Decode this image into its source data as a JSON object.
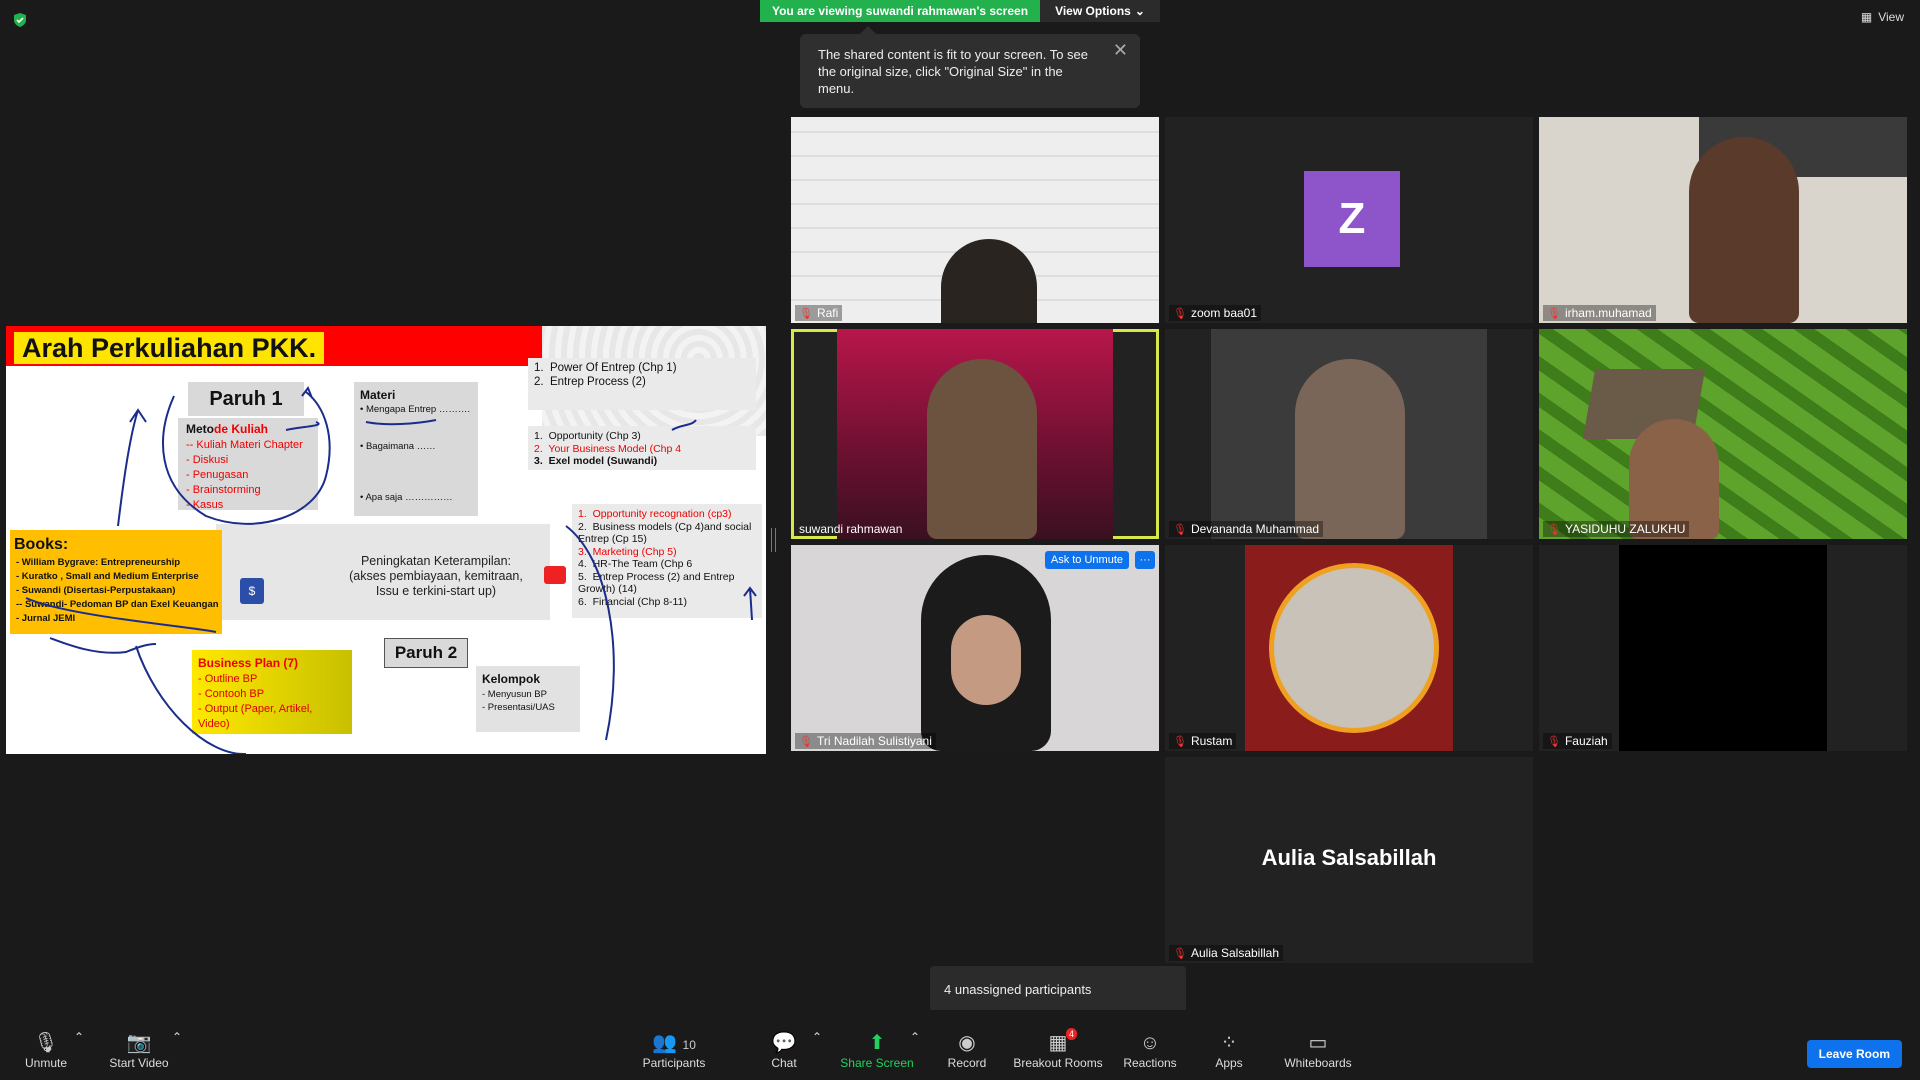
{
  "top": {
    "viewing_banner": "You are viewing suwandi rahmawan's screen",
    "view_options": "View Options",
    "view_btn": "View",
    "tooltip": "The shared content is fit to your screen. To see the original size, click \"Original Size\" in the menu."
  },
  "slide": {
    "title": "Arah Perkuliahan PKK.",
    "paruh1": "Paruh 1",
    "paruh2": "Paruh 2",
    "metode_title_a": "Meto",
    "metode_title_b": "de Kuliah",
    "metode_items": [
      "-- Kuliah Materi Chapter",
      "-  Diskusi",
      "-  Penugasan",
      "-  Brainstorming",
      "-  Kasus"
    ],
    "materi_title": "Materi",
    "materi_items": [
      "Mengapa Entrep ……….",
      "Bagaimana  ……",
      "Apa saja  ……………"
    ],
    "list1": [
      "Power Of Entrep (Chp 1)",
      "Entrep Process (2)"
    ],
    "list2": [
      "Opportunity (Chp 3)",
      "Your Business Model (Chp 4",
      "Exel model (Suwandi)"
    ],
    "list3": [
      "Opportunity recognation (cp3)",
      "Business models (Cp 4)and social Entrep (Cp 15)",
      "Marketing (Chp 5)",
      "HR-The Team (Chp 6",
      "Entrep Process (2) and Entrep Growth)  (14)",
      "Financial  (Chp 8-11)"
    ],
    "peningkatan": "Peningkatan Keterampilan:\n(akses pembiayaan, kemitraan,\nIssu e terkini-start up)",
    "books_title": "Books:",
    "books": [
      "- William Bygrave: Entrepreneurship",
      "- Kuratko , Small and Medium Enterprise",
      "- Suwandi (Disertasi-Perpustakaan)",
      "-- Suwandi- Pedoman BP dan Exel Keuangan",
      "- Jurnal JEMI"
    ],
    "bp_title": "Business Plan (7)",
    "bp_items": [
      "- Outline BP",
      "- Contooh BP",
      "- Output (Paper, Artikel,",
      "  Video)"
    ],
    "kelompok_title": "Kelompok",
    "kelompok_items": [
      "- Menyusun BP",
      "- Presentasi/UAS"
    ]
  },
  "participants": [
    {
      "name": "Rafi"
    },
    {
      "name": "zoom baa01",
      "initial": "Z"
    },
    {
      "name": "irham.muhamad"
    },
    {
      "name": "suwandi rahmawan"
    },
    {
      "name": "Devananda Muhammad"
    },
    {
      "name": "YASIDUHU ZALUKHU"
    },
    {
      "name": "Tri Nadilah Sulistiyani"
    },
    {
      "name": "Rustam"
    },
    {
      "name": "Fauziah"
    },
    {
      "name": "Aulia Salsabillah"
    }
  ],
  "tile_actions": {
    "ask_to_unmute": "Ask to Unmute",
    "more": "···"
  },
  "unassigned": "4 unassigned participants",
  "toolbar": {
    "unmute": "Unmute",
    "start_video": "Start Video",
    "participants": "Participants",
    "participants_count": "10",
    "chat": "Chat",
    "share_screen": "Share Screen",
    "record": "Record",
    "breakout_rooms": "Breakout Rooms",
    "breakout_badge": "4",
    "reactions": "Reactions",
    "apps": "Apps",
    "whiteboards": "Whiteboards",
    "leave_room": "Leave Room"
  },
  "colors": {
    "accent_green": "#23b14d",
    "zoom_blue": "#0e72ed",
    "avatar_purple": "#8e54c9",
    "active_speaker": "#d6e84a"
  }
}
